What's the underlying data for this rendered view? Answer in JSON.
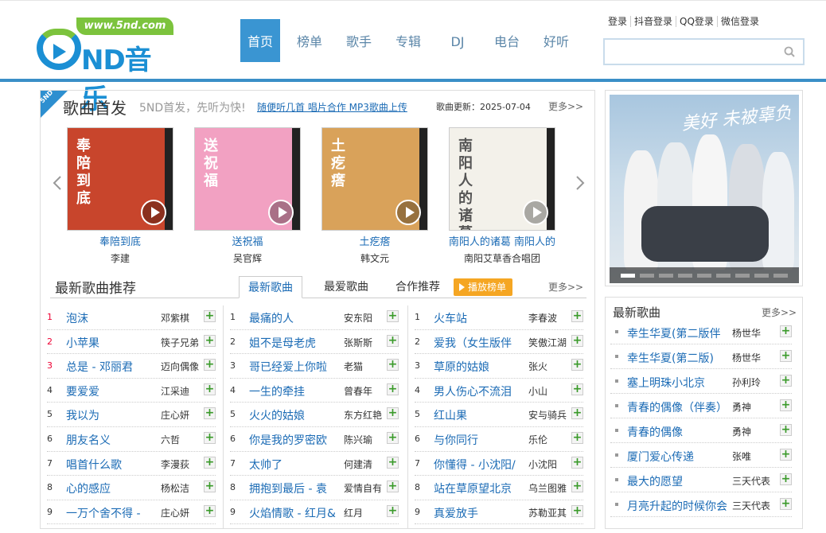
{
  "site": {
    "url_text": "www.5nd.com",
    "logo_text": "ND音乐",
    "logo_digit": "5"
  },
  "nav": [
    "首页",
    "榜单",
    "歌手",
    "专辑",
    "DJ",
    "电台",
    "好听"
  ],
  "login": [
    "登录",
    "抖音登录",
    "QQ登录",
    "微信登录"
  ],
  "search": {
    "placeholder": ""
  },
  "section": {
    "badge": "5ND",
    "title": "歌曲首发",
    "subtitle": "5ND首发，先听为快!",
    "links": "随便听几首  唱片合作 MP3歌曲上传",
    "date": "歌曲更新：2025-07-04",
    "more": "更多>>"
  },
  "albums": [
    {
      "title": "奉陪到底",
      "artist": "李建",
      "cover_color": "#c8452c",
      "cover_text": "奉陪到底"
    },
    {
      "title": "送祝福",
      "artist": "吴官辉",
      "cover_color": "#f2a1c2",
      "cover_text": "送祝福"
    },
    {
      "title": "土疙瘩",
      "artist": "韩文元",
      "cover_color": "#d9a25a",
      "cover_text": "土疙瘩"
    },
    {
      "title": "南阳人的诸葛 南阳人的",
      "artist": "南阳艾草香合唱团",
      "cover_color": "#f3f1ea",
      "cover_text": "南阳人的诸葛"
    }
  ],
  "recommend": {
    "title": "最新歌曲推荐",
    "tabs": [
      "最新歌曲",
      "最爱歌曲",
      "合作推荐"
    ],
    "play_rank": "播放榜单",
    "more": "更多>>"
  },
  "col1": [
    {
      "n": "1",
      "song": "泡沫",
      "artist": "邓紫棋"
    },
    {
      "n": "2",
      "song": "小苹果",
      "artist": "筷子兄弟"
    },
    {
      "n": "3",
      "song": "总是 - 邓丽君",
      "artist": "迈向偶像"
    },
    {
      "n": "4",
      "song": "要爱爱",
      "artist": "江采迪"
    },
    {
      "n": "5",
      "song": "我以为",
      "artist": "庄心妍"
    },
    {
      "n": "6",
      "song": "朋友名义",
      "artist": "六哲"
    },
    {
      "n": "7",
      "song": "唱首什么歌",
      "artist": "李漫荻"
    },
    {
      "n": "8",
      "song": "心的感应",
      "artist": "杨松洁"
    },
    {
      "n": "9",
      "song": "一万个舍不得 -",
      "artist": "庄心妍"
    }
  ],
  "col2": [
    {
      "n": "1",
      "song": "最痛的人",
      "artist": "安东阳"
    },
    {
      "n": "2",
      "song": "姐不是母老虎",
      "artist": "张斯斯"
    },
    {
      "n": "3",
      "song": "哥已经爱上你啦",
      "artist": "老猫"
    },
    {
      "n": "4",
      "song": "一生的牵挂",
      "artist": "曾春年"
    },
    {
      "n": "5",
      "song": "火火的姑娘",
      "artist": "东方红艳"
    },
    {
      "n": "6",
      "song": "你是我的罗密欧",
      "artist": "陈兴瑜"
    },
    {
      "n": "7",
      "song": "太帅了",
      "artist": "何建清"
    },
    {
      "n": "8",
      "song": "拥抱到最后 - 袁",
      "artist": "爱情自有"
    },
    {
      "n": "9",
      "song": "火焰情歌 - 红月&",
      "artist": "红月"
    }
  ],
  "col3": [
    {
      "n": "1",
      "song": "火车站",
      "artist": "李春波"
    },
    {
      "n": "2",
      "song": "爱我（女生版伴",
      "artist": "笑傲江湖"
    },
    {
      "n": "3",
      "song": "草原的姑娘",
      "artist": "张火"
    },
    {
      "n": "4",
      "song": "男人伤心不流泪",
      "artist": "小山"
    },
    {
      "n": "5",
      "song": "红山果",
      "artist": "安与骑兵"
    },
    {
      "n": "6",
      "song": "与你同行",
      "artist": "乐伦"
    },
    {
      "n": "7",
      "song": "你懂得 - 小沈阳/",
      "artist": "小沈阳"
    },
    {
      "n": "8",
      "song": "站在草原望北京",
      "artist": "乌兰图雅"
    },
    {
      "n": "9",
      "song": "真爱放手",
      "artist": "苏勒亚其"
    }
  ],
  "banner": {
    "script_text": "美好 未被辜负"
  },
  "newsongs": {
    "title": "最新歌曲",
    "more": "更多>>",
    "items": [
      {
        "song": "幸生华夏(第二版伴",
        "artist": "杨世华"
      },
      {
        "song": "幸生华夏(第二版)",
        "artist": "杨世华"
      },
      {
        "song": "塞上明珠小北京",
        "artist": "孙利玲"
      },
      {
        "song": "青春的偶像（伴奏）",
        "artist": "勇神"
      },
      {
        "song": "青春的偶像",
        "artist": "勇神"
      },
      {
        "song": "厦门爱心传递",
        "artist": "张唯"
      },
      {
        "song": "最大的愿望",
        "artist": "三天代表"
      },
      {
        "song": "月亮升起的时候你会",
        "artist": "三天代表"
      }
    ]
  },
  "colors": {
    "brand_blue": "#3a95d2",
    "link_blue": "#1b6bb5",
    "logo_green": "#7cc33d",
    "orange": "#f5a623"
  }
}
